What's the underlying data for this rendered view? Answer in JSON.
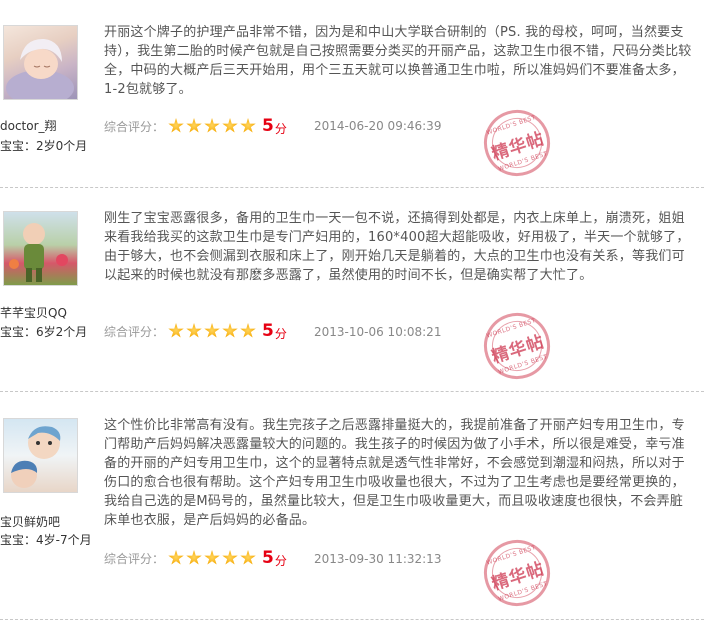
{
  "reviews": [
    {
      "username": "doctor_翔",
      "baby_age": "宝宝：2岁0个月",
      "text": "开丽这个牌子的护理产品非常不错，因为是和中山大学联合研制的（PS. 我的母校，呵呵，当然要支持），我生第二胎的时候产包就是自己按照需要分类买的开丽产品，这款卫生巾很不错，尺码分类比较全，中码的大概产后三天开始用，用个三五天就可以换普通卫生巾啦，所以准妈妈们不要准备太多，1-2包就够了。",
      "rating_label": "综合评分：",
      "stars": 5,
      "score": "5",
      "score_unit": "分",
      "date": "2014-06-20 09:46:39",
      "stamp_text": "精华帖",
      "stamp_ring": "WORLD'S BEST"
    },
    {
      "username": "芊芊宝贝QQ",
      "baby_age": "宝宝：6岁2个月",
      "text": "刚生了宝宝恶露很多，备用的卫生巾一天一包不说，还搞得到处都是，内衣上床单上，崩溃死，姐姐来看我给我买的这款卫生巾是专门产妇用的，160*400超大超能吸收，好用极了，半天一个就够了，由于够大，也不会侧漏到衣服和床上了，刚开始几天是躺着的，大点的卫生巾也没有关系，等我们可以起来的时候也就没有那麽多恶露了，虽然使用的时间不长，但是确实帮了大忙了。",
      "rating_label": "综合评分：",
      "stars": 5,
      "score": "5",
      "score_unit": "分",
      "date": "2013-10-06 10:08:21",
      "stamp_text": "精华帖",
      "stamp_ring": "WORLD'S BEST"
    },
    {
      "username": "宝贝鲜奶吧",
      "baby_age": "宝宝：4岁-7个月",
      "text": "这个性价比非常高有没有。我生完孩子之后恶露排量挺大的，我提前准备了开丽产妇专用卫生巾，专门帮助产后妈妈解决恶露量较大的问题的。我生孩子的时候因为做了小手术，所以很是难受，幸亏准备的开丽的产妇专用卫生巾，这个的显著特点就是透气性非常好，不会感觉到潮湿和闷热，所以对于伤口的愈合也很有帮助。这个产妇专用卫生巾吸收量也很大，不过为了卫生考虑也是要经常更换的，我给自己选的是M码号的，虽然量比较大，但是卫生巾吸收量更大，而且吸收速度也很快，不会弄脏床单也衣服，是产后妈妈的必备品。",
      "rating_label": "综合评分：",
      "stars": 5,
      "score": "5",
      "score_unit": "分",
      "date": "2013-09-30 11:32:13",
      "stamp_text": "精华帖",
      "stamp_ring": "WORLD'S BEST"
    }
  ],
  "colors": {
    "score": "#e60012",
    "star": "#f6a800",
    "stamp": "#cd3750",
    "divider": "#c8c8c8"
  }
}
